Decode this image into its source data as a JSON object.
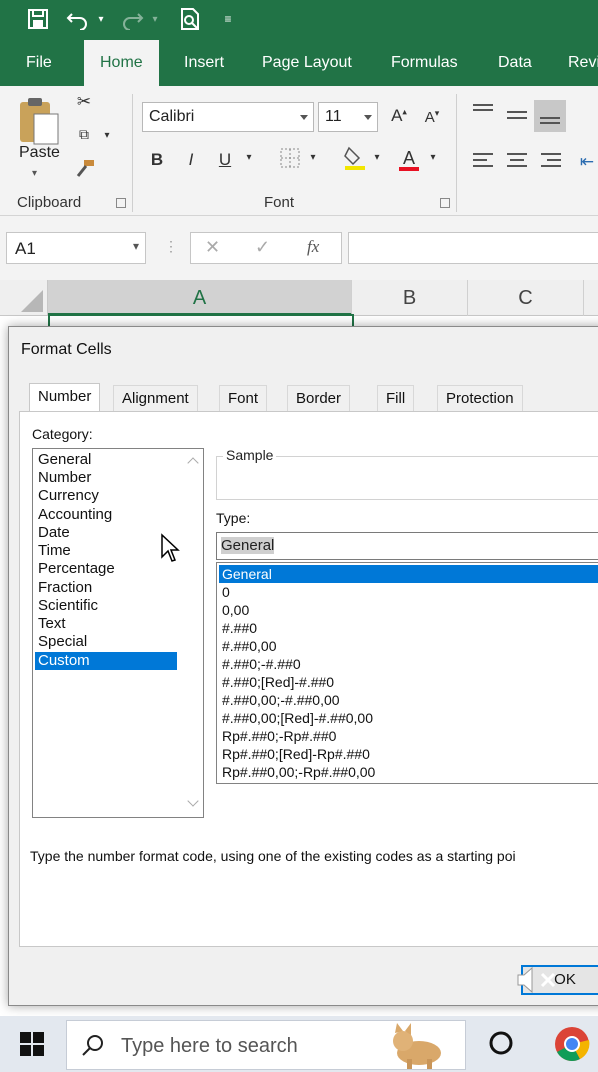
{
  "ribbon_tabs": [
    "File",
    "Home",
    "Insert",
    "Page Layout",
    "Formulas",
    "Data",
    "Revi"
  ],
  "clipboard": {
    "paste_label": "Paste",
    "group_label": "Clipboard"
  },
  "font": {
    "name": "Calibri",
    "size": "11",
    "group_label": "Font",
    "bold": "B",
    "italic": "I",
    "underline": "U"
  },
  "namebox": {
    "value": "A1"
  },
  "fx_label": "fx",
  "columns": [
    "A",
    "B",
    "C"
  ],
  "dialog": {
    "title": "Format Cells",
    "tabs": [
      "Number",
      "Alignment",
      "Font",
      "Border",
      "Fill",
      "Protection"
    ],
    "category_label": "Category:",
    "categories": [
      "General",
      "Number",
      "Currency",
      "Accounting",
      "Date",
      "Time",
      "Percentage",
      "Fraction",
      "Scientific",
      "Text",
      "Special",
      "Custom"
    ],
    "selected_category": "Custom",
    "sample_label": "Sample",
    "type_label": "Type:",
    "type_value": "General",
    "type_list": [
      "General",
      "0",
      "0,00",
      "#.##0",
      "#.##0,00",
      "#.##0;-#.##0",
      "#.##0;[Red]-#.##0",
      "#.##0,00;-#.##0,00",
      "#.##0,00;[Red]-#.##0,00",
      "Rp#.##0;-Rp#.##0",
      "Rp#.##0;[Red]-Rp#.##0",
      "Rp#.##0,00;-Rp#.##0,00"
    ],
    "selected_type": "General",
    "hint": "Type the number format code, using one of the existing codes as a starting poi",
    "ok_label": "OK"
  },
  "taskbar": {
    "search_placeholder": "Type here to search"
  },
  "colors": {
    "excel_green": "#217346",
    "selection_blue": "#0078d7",
    "font_color_red": "#e81123"
  }
}
